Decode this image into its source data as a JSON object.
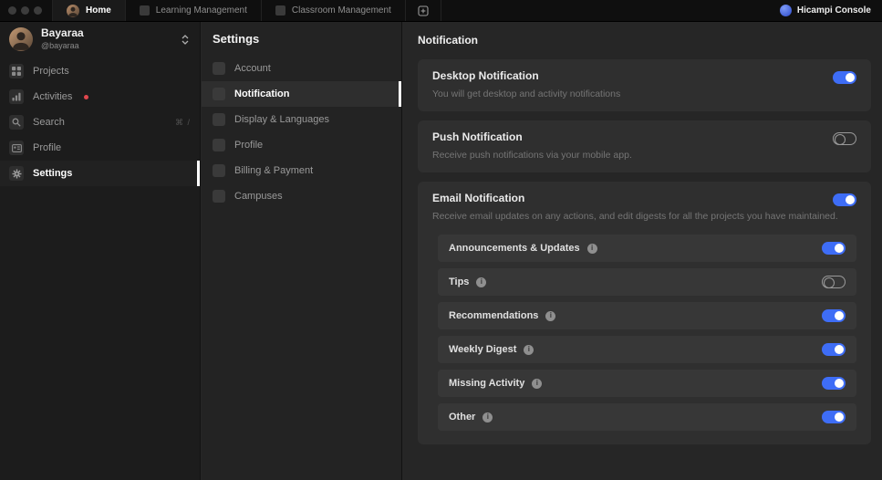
{
  "topbar": {
    "tabs": [
      {
        "label": "Home",
        "active": true
      },
      {
        "label": "Learning Management",
        "active": false
      },
      {
        "label": "Classroom Management",
        "active": false
      }
    ],
    "console_label": "Hicampi Console"
  },
  "sidebar": {
    "user": {
      "name": "Bayaraa",
      "handle": "@bayaraa"
    },
    "items": [
      {
        "label": "Projects"
      },
      {
        "label": "Activities",
        "badge": true
      },
      {
        "label": "Search",
        "shortcut": "⌘ /"
      },
      {
        "label": "Profile"
      },
      {
        "label": "Settings",
        "active": true
      }
    ]
  },
  "subnav": {
    "title": "Settings",
    "items": [
      {
        "label": "Account"
      },
      {
        "label": "Notification",
        "active": true
      },
      {
        "label": "Display & Languages"
      },
      {
        "label": "Profile"
      },
      {
        "label": "Billing & Payment"
      },
      {
        "label": "Campuses"
      }
    ]
  },
  "main": {
    "title": "Notification",
    "cards": [
      {
        "title": "Desktop Notification",
        "description": "You will get desktop and activity notifications",
        "enabled": true
      },
      {
        "title": "Push Notification",
        "description": "Receive push notifications via your mobile app.",
        "enabled": false
      },
      {
        "title": "Email Notification",
        "description": "Receive email updates on any actions, and edit digests for all the projects you have maintained.",
        "enabled": true,
        "subitems": [
          {
            "label": "Announcements & Updates",
            "enabled": true
          },
          {
            "label": "Tips",
            "enabled": false
          },
          {
            "label": "Recommendations",
            "enabled": true
          },
          {
            "label": "Weekly Digest",
            "enabled": true
          },
          {
            "label": "Missing Activity",
            "enabled": true
          },
          {
            "label": "Other",
            "enabled": true
          }
        ]
      }
    ]
  },
  "colors": {
    "accent": "#3e6df6",
    "badge": "#e0474d"
  }
}
